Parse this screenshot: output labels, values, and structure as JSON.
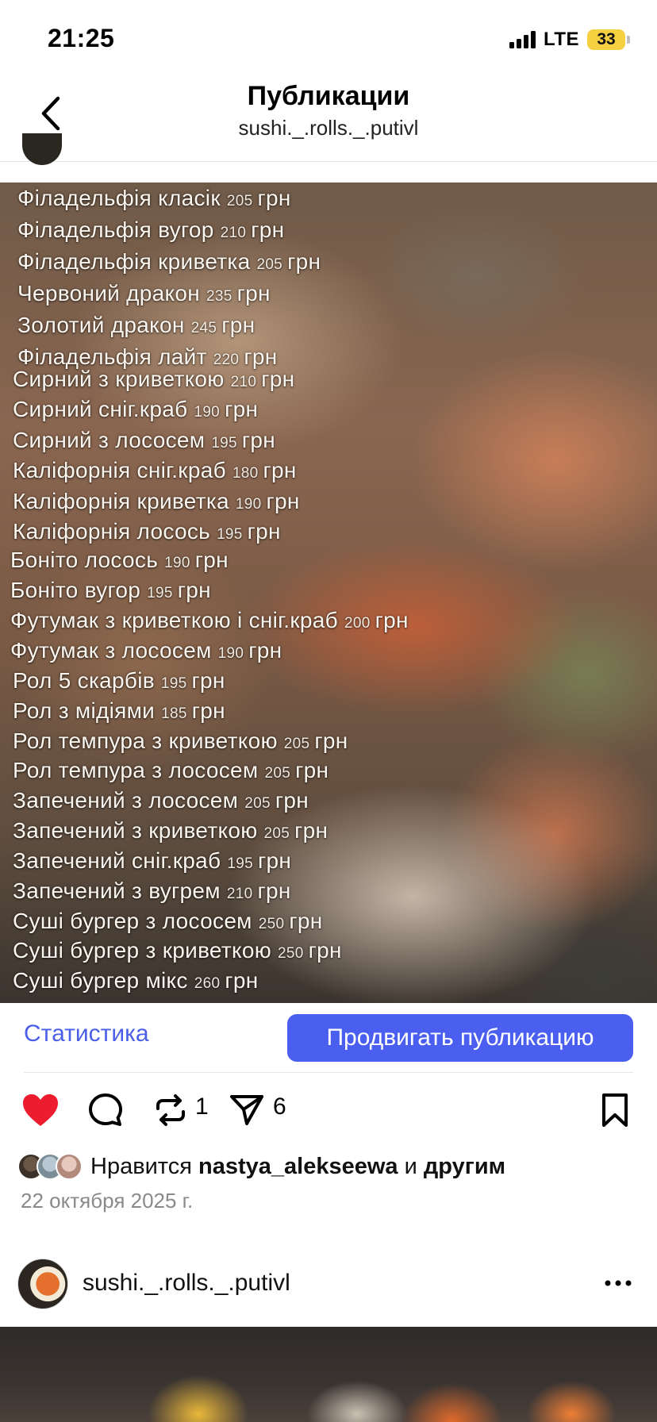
{
  "status_bar": {
    "time": "21:25",
    "network": "LTE",
    "battery": "33",
    "battery_color": "#f5d142"
  },
  "header": {
    "title": "Публикации",
    "subtitle": "sushi._.rolls._.putivl"
  },
  "menu": {
    "items": [
      {
        "name": "Філадельфія класік",
        "price": "205",
        "currency": "грн"
      },
      {
        "name": "Філадельфія вугор",
        "price": "210",
        "currency": "грн"
      },
      {
        "name": "Філадельфія криветка",
        "price": "205",
        "currency": "грн"
      },
      {
        "name": "Червоний дракон",
        "price": "235",
        "currency": "грн"
      },
      {
        "name": "Золотий дракон",
        "price": "245",
        "currency": "грн"
      },
      {
        "name": "Філадельфія лайт",
        "price": "220",
        "currency": "грн"
      },
      {
        "name": "Сирний з криветкою",
        "price": "210",
        "currency": "грн"
      },
      {
        "name": "Сирний сніг.краб",
        "price": "190",
        "currency": "грн"
      },
      {
        "name": "Сирний з лососем",
        "price": "195",
        "currency": "грн"
      },
      {
        "name": "Каліфорнія сніг.краб",
        "price": "180",
        "currency": "грн"
      },
      {
        "name": "Каліфорнія криветка",
        "price": "190",
        "currency": "грн"
      },
      {
        "name": "Каліфорнія лосось",
        "price": "195",
        "currency": "грн"
      },
      {
        "name": "Боніто лосось",
        "price": "190",
        "currency": "грн"
      },
      {
        "name": "Боніто вугор",
        "price": "195",
        "currency": "грн"
      },
      {
        "name": "Футумак з криветкою і сніг.краб",
        "price": "200",
        "currency": "грн"
      },
      {
        "name": "Футумак з лососем",
        "price": "190",
        "currency": "грн"
      },
      {
        "name": "Рол 5 скарбів",
        "price": "195",
        "currency": "грн"
      },
      {
        "name": "Рол з мідіями",
        "price": "185",
        "currency": "грн"
      },
      {
        "name": "Рол темпура з криветкою",
        "price": "205",
        "currency": "грн"
      },
      {
        "name": "Рол темпура з лососем",
        "price": "205",
        "currency": "грн"
      },
      {
        "name": "Запечений з лососем",
        "price": "205",
        "currency": "грн"
      },
      {
        "name": "Запечений з криветкою",
        "price": "205",
        "currency": "грн"
      },
      {
        "name": "Запечений сніг.краб",
        "price": "195",
        "currency": "грн"
      },
      {
        "name": "Запечений з вугрем",
        "price": "210",
        "currency": "грн"
      },
      {
        "name": "Суші бургер з лососем",
        "price": "250",
        "currency": "грн"
      },
      {
        "name": "Суші бургер з криветкою",
        "price": "250",
        "currency": "грн"
      },
      {
        "name": "Суші бургер мікс",
        "price": "260",
        "currency": "грн"
      }
    ]
  },
  "actions": {
    "stats_label": "Статистика",
    "promote_label": "Продвигать публикацию",
    "accent_color": "#4a5ff0"
  },
  "engagement": {
    "like_icon": "heart-filled-icon",
    "comment_icon": "comment-icon",
    "repost_icon": "repost-icon",
    "repost_count": "1",
    "share_icon": "send-icon",
    "share_count": "6",
    "save_icon": "bookmark-icon",
    "like_color": "#ed1c2e"
  },
  "likes": {
    "prefix": "Нравится",
    "user": "nastya_alekseewa",
    "conjunction": "и",
    "others": "другим"
  },
  "post_date": "22 октября 2025 г.",
  "next_post": {
    "username": "sushi._.rolls._.putivl",
    "more_icon": "more-horizontal-icon"
  }
}
